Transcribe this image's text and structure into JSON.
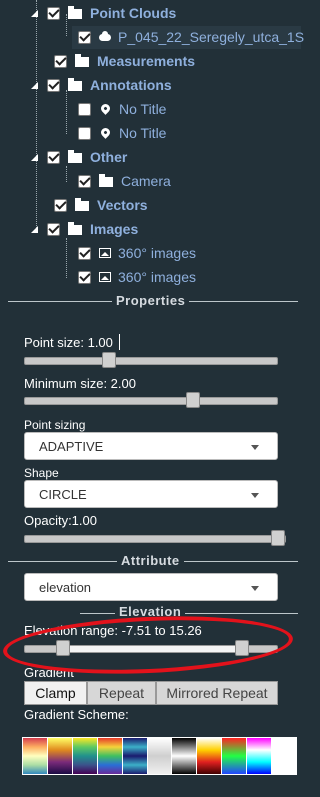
{
  "tree": {
    "items": [
      {
        "label": "Point Clouds",
        "checked": true,
        "icon": "folder-icon",
        "bold": true
      },
      {
        "label": "P_045_22_Seregely_utca_1S",
        "checked": true,
        "icon": "cloud-icon",
        "bold": false
      },
      {
        "label": "Measurements",
        "checked": true,
        "icon": "folder-icon",
        "bold": true
      },
      {
        "label": "Annotations",
        "checked": true,
        "icon": "folder-icon",
        "bold": true
      },
      {
        "label": "No Title",
        "checked": false,
        "icon": "pin-icon",
        "bold": false
      },
      {
        "label": "No Title",
        "checked": false,
        "icon": "pin-icon",
        "bold": false
      },
      {
        "label": "Other",
        "checked": true,
        "icon": "folder-icon",
        "bold": true
      },
      {
        "label": "Camera",
        "checked": true,
        "icon": "folder-icon",
        "bold": false
      },
      {
        "label": "Vectors",
        "checked": true,
        "icon": "folder-icon",
        "bold": true
      },
      {
        "label": "Images",
        "checked": true,
        "icon": "folder-icon",
        "bold": true
      },
      {
        "label": "360° images",
        "checked": true,
        "icon": "image-icon",
        "bold": false
      },
      {
        "label": "360° images",
        "checked": true,
        "icon": "image-icon",
        "bold": false
      }
    ]
  },
  "properties": {
    "title": "Properties",
    "point_size_label": "Point size: 1.00",
    "point_size_value": 0.31,
    "min_size_label": "Minimum size: 2.00",
    "min_size_value": 0.67,
    "point_sizing_label": "Point sizing",
    "point_sizing_value": "ADAPTIVE",
    "shape_label": "Shape",
    "shape_value": "CIRCLE",
    "opacity_label": "Opacity:1.00",
    "opacity_value": 1.0
  },
  "attribute": {
    "title": "Attribute",
    "selected": "elevation"
  },
  "elevation": {
    "title": "Elevation",
    "range_label": "Elevation range: -7.51 to 15.26",
    "range_low": -7.51,
    "range_high": 15.26,
    "gradient_label": "Gradient",
    "buttons": [
      "Clamp",
      "Repeat",
      "Mirrored Repeat"
    ],
    "active_button": "Clamp",
    "scheme_label": "Gradient Scheme:"
  },
  "colors": {
    "background": "#223038",
    "tree_text": "#8fb0dd",
    "annotation": "#e3121b"
  }
}
